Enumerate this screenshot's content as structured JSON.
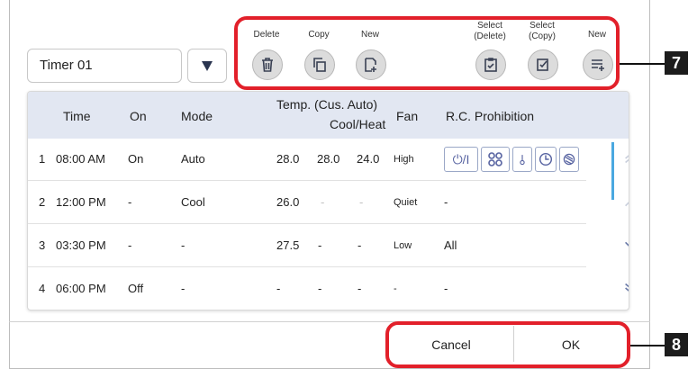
{
  "timer": {
    "selected": "Timer 01"
  },
  "toolbar": {
    "delete_label": "Delete",
    "copy_label": "Copy",
    "new_label": "New",
    "select_delete_label_1": "Select",
    "select_delete_label_2": "(Delete)",
    "select_copy_label_1": "Select",
    "select_copy_label_2": "(Copy)",
    "new_timer_label": "New"
  },
  "table": {
    "headers": {
      "time": "Time",
      "on": "On",
      "mode": "Mode",
      "temp": "Temp. (Cus. Auto)",
      "coolheat": "Cool/Heat",
      "fan": "Fan",
      "rc": "R.C. Prohibition"
    },
    "rows": [
      {
        "num": "1",
        "time": "08:00 AM",
        "on": "On",
        "mode": "Auto",
        "t1": "28.0",
        "t2": "28.0",
        "t3": "24.0",
        "fan": "High",
        "rc": ""
      },
      {
        "num": "2",
        "time": "12:00 PM",
        "on": "-",
        "mode": "Cool",
        "t1": "26.0",
        "t2": "-",
        "t3": "-",
        "fan": "Quiet",
        "rc": "-"
      },
      {
        "num": "3",
        "time": "03:30 PM",
        "on": "-",
        "mode": "-",
        "t1": "27.5",
        "t2": "-",
        "t3": "-",
        "fan": "Low",
        "rc": "All"
      },
      {
        "num": "4",
        "time": "06:00 PM",
        "on": "Off",
        "mode": "-",
        "t1": "-",
        "t2": "-",
        "t3": "-",
        "fan": "-",
        "rc": "-"
      }
    ],
    "rc_icons": {
      "power": "⏻/I"
    }
  },
  "footer": {
    "cancel_label": "Cancel",
    "ok_label": "OK"
  },
  "callouts": {
    "toolbar_marker": "7",
    "footer_marker": "8"
  },
  "colors": {
    "highlight": "#e2202a",
    "header_bg": "#e2e7f2",
    "scroll_accent": "#4aa8e0"
  }
}
